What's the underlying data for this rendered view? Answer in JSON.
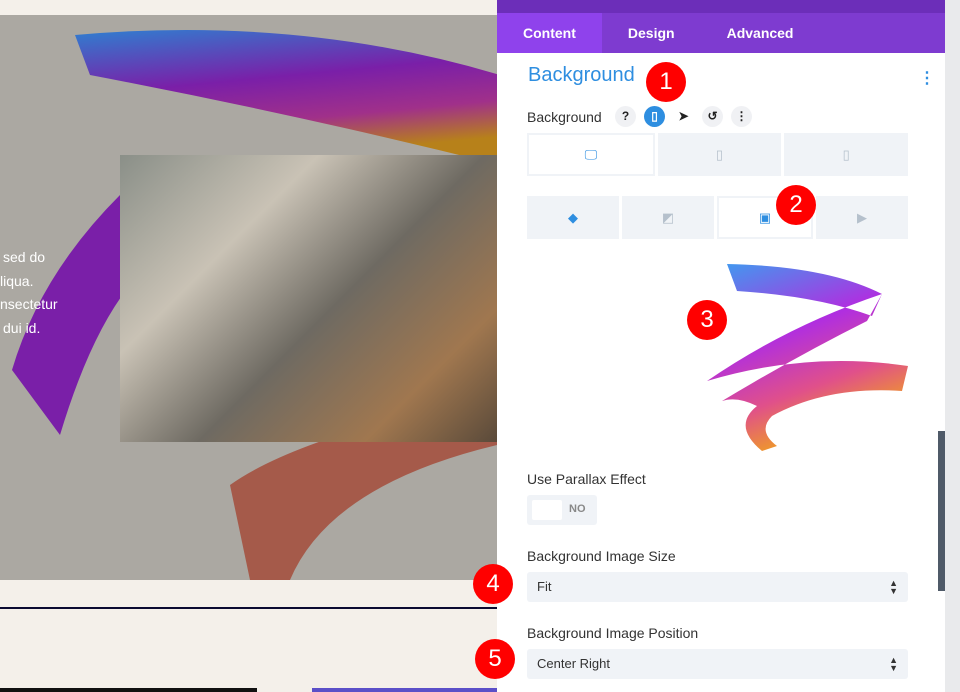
{
  "preview": {
    "text_lines": [
      "sed do",
      "liqua.",
      "nsectetur",
      "dui id."
    ]
  },
  "tabs": [
    {
      "label": "Content",
      "active": true
    },
    {
      "label": "Design"
    },
    {
      "label": "Advanced"
    }
  ],
  "section_title": "Background",
  "background_label": "Background",
  "field_icons": [
    "help-icon",
    "mobile-icon",
    "cursor-icon",
    "reset-icon",
    "more-icon"
  ],
  "device_tabs": [
    "desktop",
    "tablet",
    "phone"
  ],
  "bg_type_tabs": [
    "color",
    "gradient",
    "image",
    "video"
  ],
  "parallax": {
    "label": "Use Parallax Effect",
    "value": "NO"
  },
  "image_size": {
    "label": "Background Image Size",
    "value": "Fit"
  },
  "image_position": {
    "label": "Background Image Position",
    "value": "Center Right"
  },
  "badges": [
    "1",
    "2",
    "3",
    "4",
    "5"
  ],
  "colors": {
    "accent": "#2e8ee0",
    "tabs": "#7e3bd0",
    "badge": "#ff0000"
  }
}
